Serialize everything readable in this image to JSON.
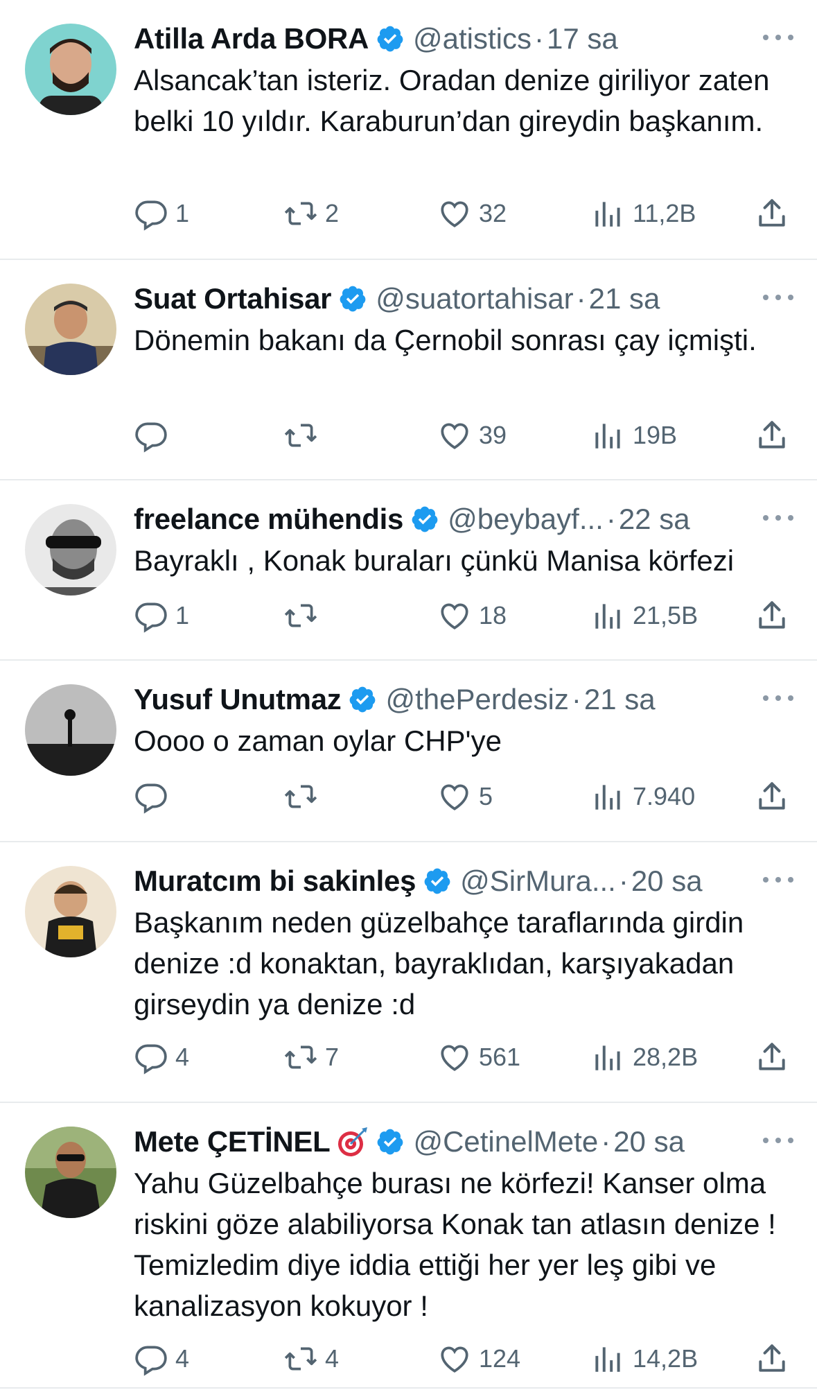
{
  "tweets": [
    {
      "name": "Atilla Arda BORA",
      "handle": "@atistics",
      "time": "17 sa",
      "text": "Alsancak’tan isteriz. Oradan denize giriliyor zaten belki 10 yıldır. Karaburun’dan gireydin başkanım.",
      "replies": "1",
      "retweets": "2",
      "likes": "32",
      "views": "11,2B",
      "emoji": ""
    },
    {
      "name": "Suat Ortahisar",
      "handle": "@suatortahisar",
      "time": "21 sa",
      "text": "Dönemin bakanı da Çernobil sonrası çay içmişti.",
      "replies": "",
      "retweets": "",
      "likes": "39",
      "views": "19B",
      "emoji": ""
    },
    {
      "name": "freelance mühendis",
      "handle": "@beybayf...",
      "time": "22 sa",
      "text": "Bayraklı , Konak buraları çünkü Manisa körfezi",
      "replies": "1",
      "retweets": "",
      "likes": "18",
      "views": "21,5B",
      "emoji": ""
    },
    {
      "name": "Yusuf Unutmaz",
      "handle": "@thePerdesiz",
      "time": "21 sa",
      "text": "Oooo o zaman oylar CHP'ye",
      "replies": "",
      "retweets": "",
      "likes": "5",
      "views": "7.940",
      "emoji": ""
    },
    {
      "name": "Muratcım bi sakinleş",
      "handle": "@SirMura...",
      "time": "20 sa",
      "text": "Başkanım neden güzelbahçe taraflarında girdin denize :d konaktan, bayraklıdan, karşıyakadan girseydin ya denize :d",
      "replies": "4",
      "retweets": "7",
      "likes": "561",
      "views": "28,2B",
      "emoji": ""
    },
    {
      "name": "Mete ÇETİNEL",
      "handle": "@CetinelMete",
      "time": "20 sa",
      "text": "Yahu Güzelbahçe burası ne körfezi! Kanser olma riskini göze alabiliyorsa Konak tan atlasın denize ! Temizledim diye iddia ettiği her yer leş gibi ve kanalizasyon kokuyor !",
      "replies": "4",
      "retweets": "4",
      "likes": "124",
      "views": "14,2B",
      "emoji": "direct-hit-icon"
    }
  ],
  "colors": {
    "verified": "#1d9bf0",
    "secondary": "#536471",
    "divider": "#e8ebed"
  }
}
